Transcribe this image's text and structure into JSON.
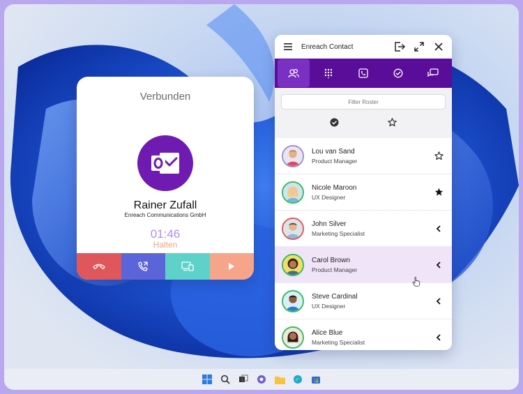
{
  "call": {
    "status": "Verbunden",
    "name": "Rainer Zufall",
    "company": "Enreach Communications GmbH",
    "timer": "01:46",
    "hold_status": "Halten",
    "avatar_icon": "outlook-icon",
    "actions": [
      {
        "icon": "hangup-icon",
        "color": "#e0575b"
      },
      {
        "icon": "transfer-call-icon",
        "color": "#5b64d8"
      },
      {
        "icon": "device-switch-icon",
        "color": "#5ed1c9"
      },
      {
        "icon": "play-icon",
        "color": "#f7a58a"
      }
    ]
  },
  "panel": {
    "title": "Enreach Contact",
    "header_icons": [
      "menu-icon",
      "logout-icon",
      "expand-icon",
      "close-icon"
    ],
    "tabs": [
      "contacts-icon",
      "dialpad-icon",
      "call-log-icon",
      "presence-icon",
      "chat-icon"
    ],
    "active_tab": 0,
    "filter": {
      "placeholder": "Filter Roster"
    },
    "filter_icons": [
      "check-circle-icon",
      "star-outline-icon"
    ],
    "contacts": [
      {
        "name": "Lou van Sand",
        "role": "Product Manager",
        "ring": "#9e8fd4",
        "action": "star-outline-icon"
      },
      {
        "name": "Nicole Maroon",
        "role": "UX Designer",
        "ring": "#2fbf5a",
        "action": "star-filled-icon"
      },
      {
        "name": "John Silver",
        "role": "Marketing Specialist",
        "ring": "#e0575b",
        "action": "chevron-left-icon"
      },
      {
        "name": "Carol Brown",
        "role": "Product Manager",
        "ring": "#2fbf5a",
        "action": "chevron-left-icon",
        "selected": true
      },
      {
        "name": "Steve Cardinal",
        "role": "UX Designer",
        "ring": "#2fbf5a",
        "action": "chevron-left-icon"
      },
      {
        "name": "Alice Blue",
        "role": "Marketing Specialist",
        "ring": "#2fbf5a",
        "action": "chevron-left-icon"
      }
    ]
  },
  "colors": {
    "brand_purple": "#5a0d99",
    "accent_purple": "#7b30c4",
    "selected_row": "#efe4f8"
  },
  "taskbar": {
    "icons": [
      "windows-start-icon",
      "search-icon",
      "task-view-icon",
      "chat-app-icon",
      "file-explorer-icon",
      "edge-browser-icon",
      "store-icon"
    ]
  }
}
